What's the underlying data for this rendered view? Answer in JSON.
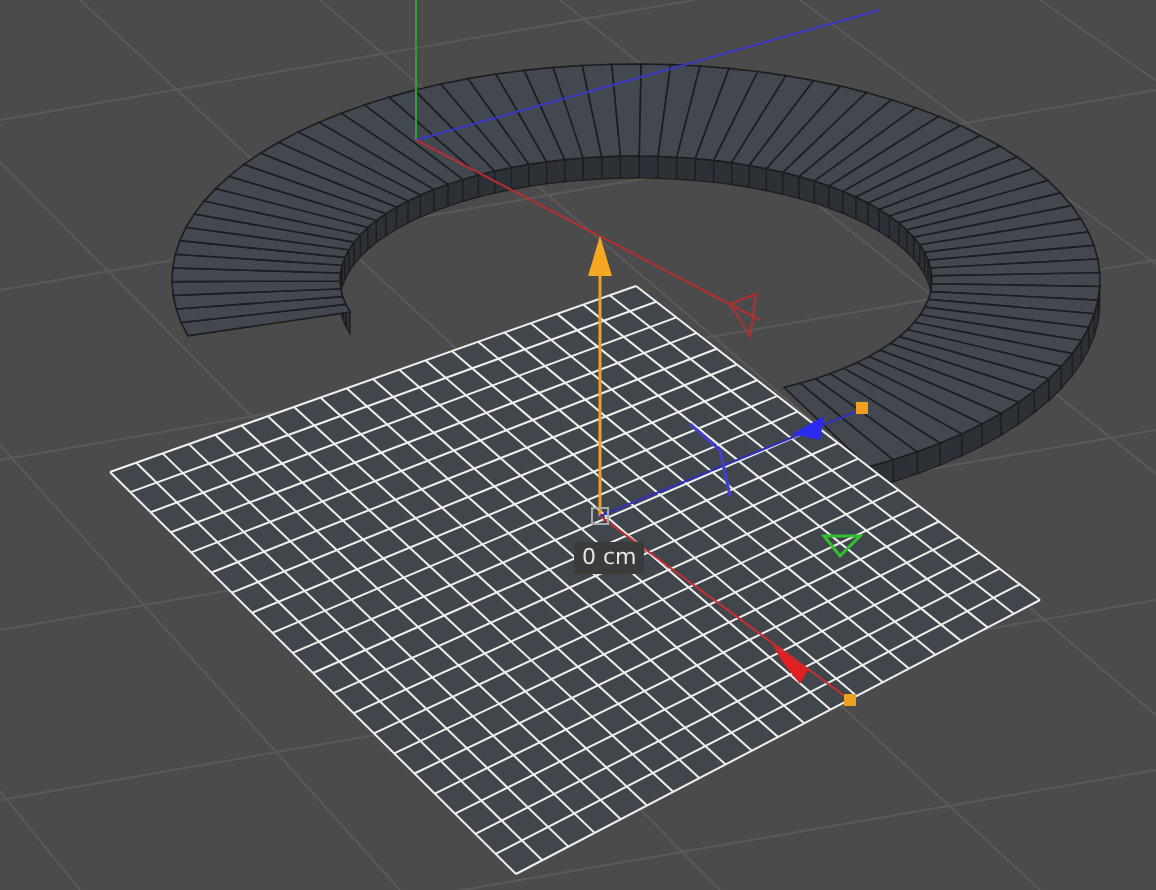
{
  "viewport": {
    "distance_label": "0 cm"
  }
}
